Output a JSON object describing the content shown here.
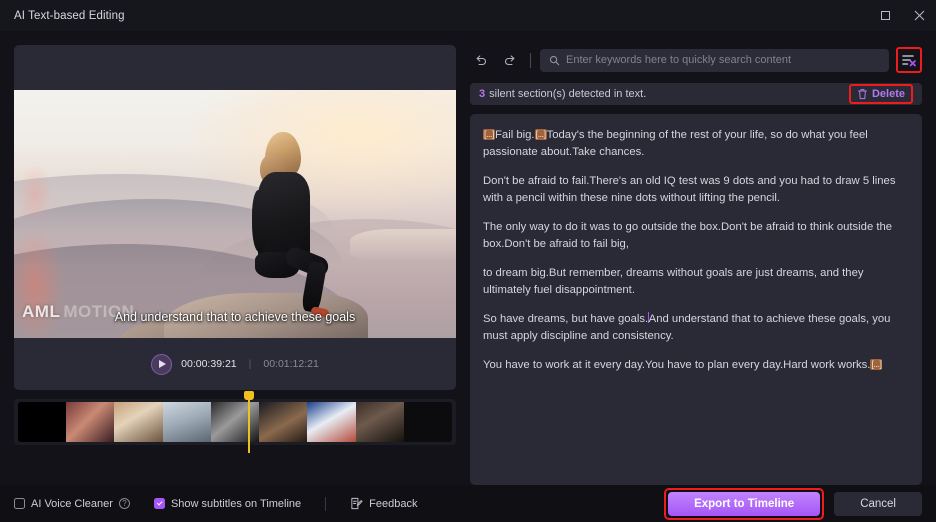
{
  "window": {
    "title": "AI Text-based Editing",
    "maximize_icon": "maximize-icon",
    "close_icon": "close-icon"
  },
  "player": {
    "subtitle_overlay": "And understand that to achieve these goals",
    "watermark_primary": "AML",
    "watermark_secondary": "MOTION",
    "play_icon": "play-icon",
    "current_time": "00:00:39:21",
    "time_separator": "|",
    "total_time": "00:01:12:21",
    "thumbnail_count": 8
  },
  "toolbar": {
    "undo_icon": "undo-icon",
    "redo_icon": "redo-icon",
    "search_icon": "search-icon",
    "search_value": "",
    "search_placeholder": "Enter keywords here to quickly search content",
    "filter_icon": "remove-silence-icon",
    "filter_highlight_color": "#ee1c1c"
  },
  "notice": {
    "count": "3",
    "text": "silent section(s) detected in text.",
    "delete_icon": "trash-icon",
    "delete_label": "Delete",
    "accent_color": "#b478f0",
    "highlight_color": "#ee1c1c"
  },
  "transcript": {
    "gap_marker": "[...]",
    "paragraphs": [
      {
        "id": "p1",
        "segments": [
          {
            "type": "gap",
            "text": "[...]"
          },
          {
            "type": "text",
            "text": "Fail big."
          },
          {
            "type": "gap",
            "text": "[...]"
          },
          {
            "type": "text",
            "text": "Today's the beginning of the rest of your life, so do what you feel passionate about.Take chances."
          }
        ]
      },
      {
        "id": "p2",
        "segments": [
          {
            "type": "text",
            "text": "Don't be afraid to fail.There's an old IQ test was 9 dots and you had to draw 5 lines with a pencil within these nine dots without lifting the pencil."
          }
        ]
      },
      {
        "id": "p3",
        "segments": [
          {
            "type": "text",
            "text": "The only way to do it was to go outside the box.Don't be afraid to think outside the box.Don't be afraid to fail big,"
          }
        ]
      },
      {
        "id": "p4",
        "segments": [
          {
            "type": "text",
            "text": " to dream big.But remember, dreams without goals are just dreams, and they ultimately fuel disappointment."
          }
        ]
      },
      {
        "id": "p5",
        "segments": [
          {
            "type": "text",
            "text": "So have dreams, but have goals."
          },
          {
            "type": "caret",
            "text": ""
          },
          {
            "type": "text",
            "text": "And understand that to achieve these goals, you must apply discipline and consistency."
          }
        ]
      },
      {
        "id": "p6",
        "segments": [
          {
            "type": "text",
            "text": "You have to work at it every day.You have to plan every day.Hard work works."
          },
          {
            "type": "gap",
            "text": "[...]"
          }
        ]
      }
    ]
  },
  "footer": {
    "voice_cleaner_label": "AI Voice Cleaner",
    "voice_cleaner_checked": false,
    "help_icon": "help-icon",
    "subtitles_label": "Show subtitles on Timeline",
    "subtitles_checked": true,
    "feedback_icon": "feedback-icon",
    "feedback_label": "Feedback",
    "export_label": "Export to Timeline",
    "cancel_label": "Cancel",
    "export_color": "#a855f7",
    "export_highlight_color": "#ee1c1c"
  }
}
